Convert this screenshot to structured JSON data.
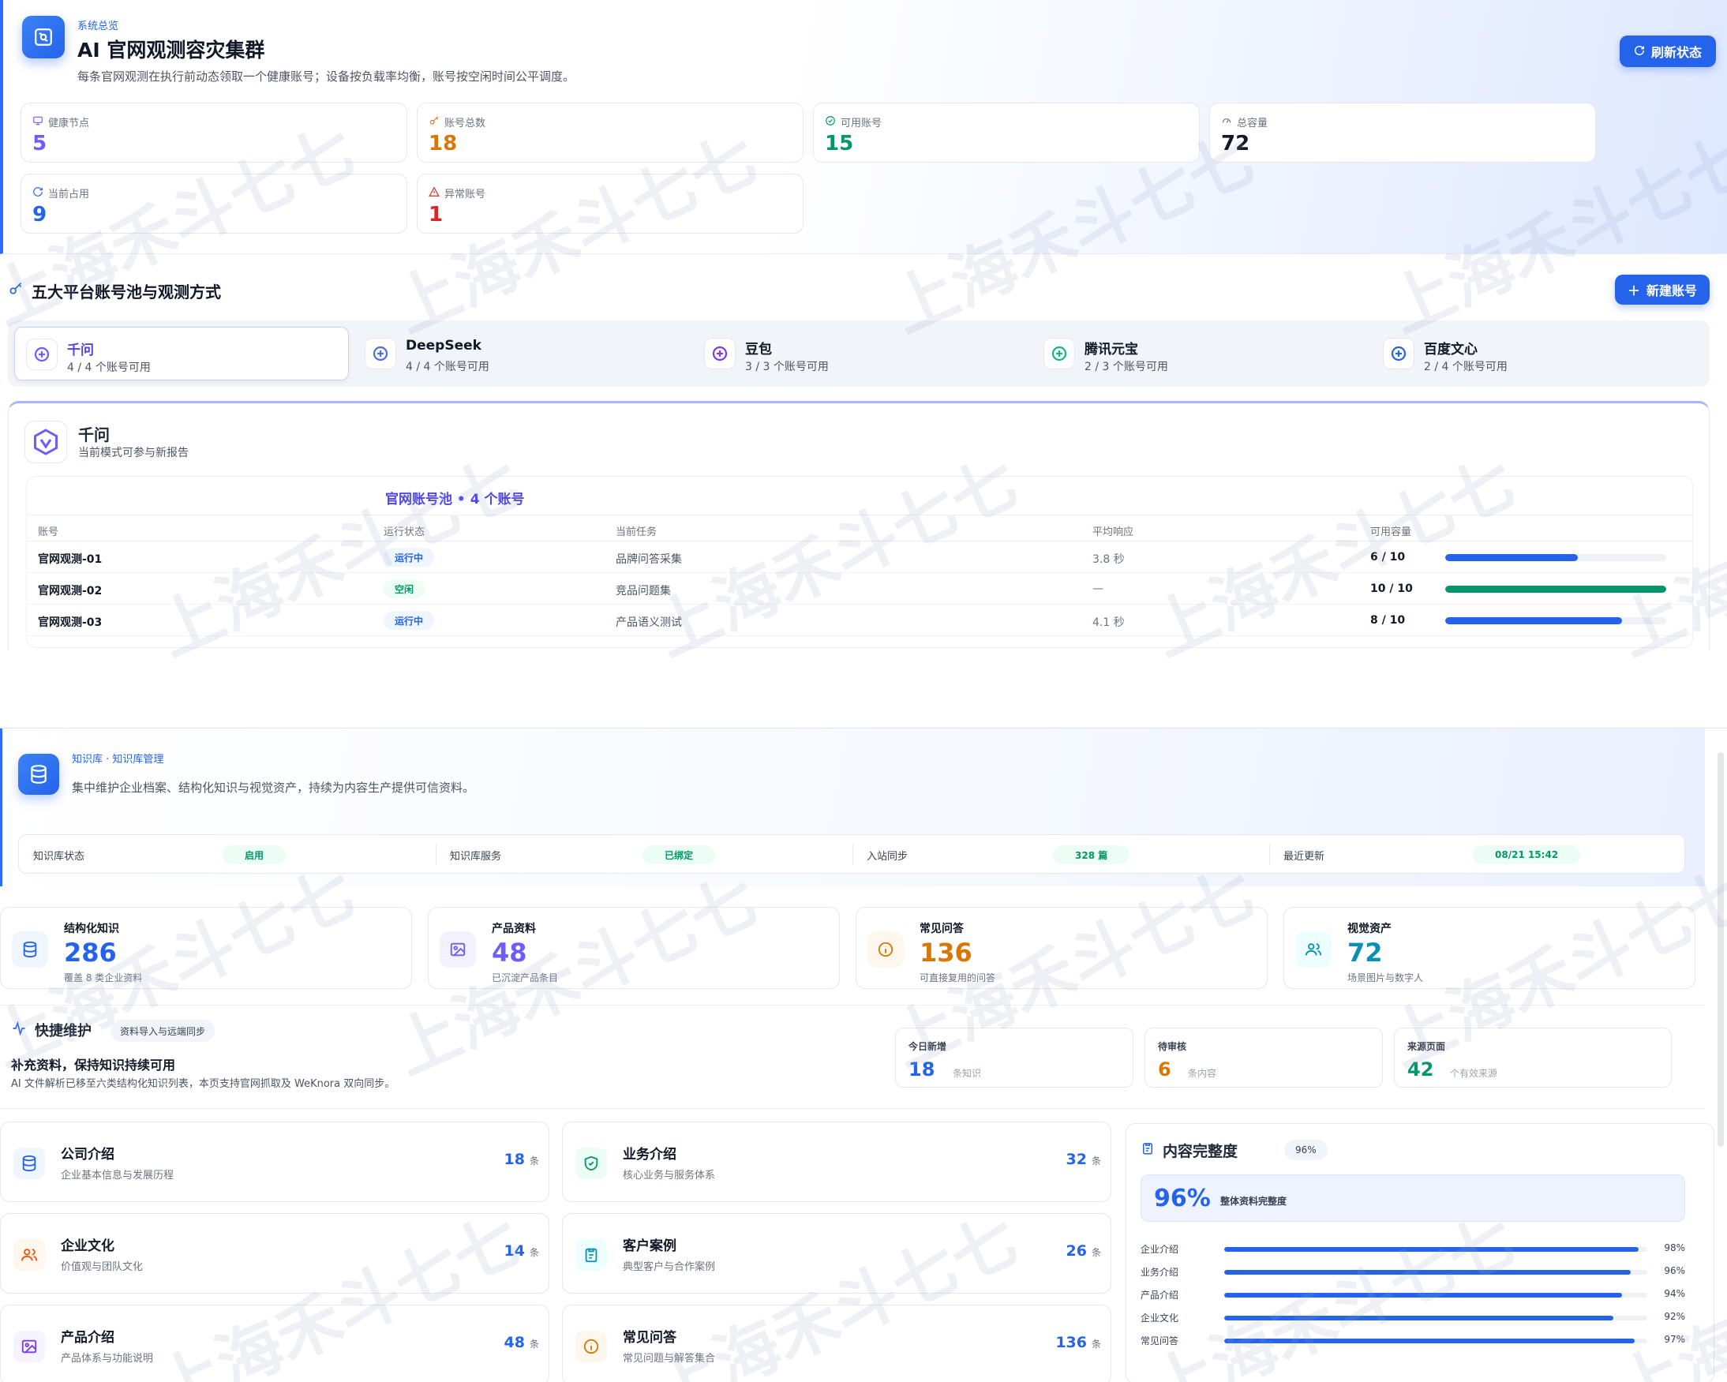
{
  "cluster": {
    "crumb": "系统总览",
    "title": "AI 官网观测容灾集群",
    "subtitle": "每条官网观测在执行前动态领取一个健康账号；设备按负载率均衡，账号按空闲时间公平调度。",
    "refresh_label": "刷新状态",
    "stats": [
      {
        "label": "健康节点",
        "value": "5",
        "icon": "monitor-icon",
        "color": "#6d5dfc"
      },
      {
        "label": "账号总数",
        "value": "18",
        "icon": "key-icon",
        "color": "#d97706"
      },
      {
        "label": "可用账号",
        "value": "15",
        "icon": "check-circle-icon",
        "color": "#059669"
      },
      {
        "label": "总容量",
        "value": "72",
        "icon": "gauge-icon",
        "color": "#111827"
      },
      {
        "label": "当前占用",
        "value": "9",
        "icon": "refresh-icon",
        "color": "#2563eb"
      },
      {
        "label": "异常账号",
        "value": "1",
        "icon": "warning-icon",
        "color": "#dc2626"
      }
    ]
  },
  "pool_section": {
    "title": "五大平台账号池与观测方式",
    "new_account_label": "新建账号",
    "platforms": [
      {
        "name": "千问",
        "count": "4 / 4 个账号可用",
        "active": true,
        "color": "#6d5dfc"
      },
      {
        "name": "DeepSeek",
        "count": "4 / 4 个账号可用",
        "active": false,
        "color": "#4f6bed"
      },
      {
        "name": "豆包",
        "count": "3 / 3 个账号可用",
        "active": false,
        "color": "#7c3aed"
      },
      {
        "name": "腾讯元宝",
        "count": "2 / 3 个账号可用",
        "active": false,
        "color": "#10b981"
      },
      {
        "name": "百度文心",
        "count": "2 / 4 个账号可用",
        "active": false,
        "color": "#2563eb"
      }
    ],
    "detail": {
      "name": "千问",
      "subtitle": "当前模式可参与新报告",
      "pool_title": "官网账号池 • 4 个账号",
      "columns": [
        "账号",
        "运行状态",
        "当前任务",
        "平均响应",
        "可用容量"
      ],
      "rows": [
        {
          "account": "官网观测-01",
          "status": "运行中",
          "status_type": "run",
          "task": "品牌问答采集",
          "latency": "3.8 秒",
          "capacity": "6 / 10",
          "fill": 0.6,
          "bar_color": "#2563eb"
        },
        {
          "account": "官网观测-02",
          "status": "空闲",
          "status_type": "idle",
          "task": "竞品问题集",
          "latency": "—",
          "capacity": "10 / 10",
          "fill": 1.0,
          "bar_color": "#059669"
        },
        {
          "account": "官网观测-03",
          "status": "运行中",
          "status_type": "run",
          "task": "产品语义测试",
          "latency": "4.1 秒",
          "capacity": "8 / 10",
          "fill": 0.8,
          "bar_color": "#2563eb"
        }
      ]
    }
  },
  "knowledge": {
    "crumb": "知识库 · 知识库管理",
    "subtitle": "集中维护企业档案、结构化知识与视觉资产，持续为内容生产提供可信资料。",
    "strip": [
      {
        "label": "知识库状态",
        "value": "启用"
      },
      {
        "label": "知识库服务",
        "value": "已绑定"
      },
      {
        "label": "入站同步",
        "value": "328 篇"
      },
      {
        "label": "最近更新",
        "value": "08/21 15:42"
      }
    ],
    "cards": [
      {
        "title": "结构化知识",
        "value": "286",
        "sub": "覆盖 8 类企业资料",
        "icon": "database-icon",
        "color": "#2563eb",
        "bg": "#eff6ff"
      },
      {
        "title": "产品资料",
        "value": "48",
        "sub": "已沉淀产品条目",
        "icon": "image-icon",
        "color": "#6d5dfc",
        "bg": "#f3f0ff"
      },
      {
        "title": "常见问答",
        "value": "136",
        "sub": "可直接复用的问答",
        "icon": "info-icon",
        "color": "#d97706",
        "bg": "#fff7ed"
      },
      {
        "title": "视觉资产",
        "value": "72",
        "sub": "场景图片与数字人",
        "icon": "users-icon",
        "color": "#0891b2",
        "bg": "#ecfeff"
      }
    ],
    "quick": {
      "title": "快捷维护",
      "tag": "资料导入与远端同步",
      "heading": "补充资料，保持知识持续可用",
      "desc": "AI 文件解析已移至六类结构化知识列表，本页支持官网抓取及 WeKnora 双向同步。",
      "stats": [
        {
          "label": "今日新增",
          "value": "18",
          "unit": "条知识",
          "color": "#2563eb"
        },
        {
          "label": "待审核",
          "value": "6",
          "unit": "条内容",
          "color": "#d97706"
        },
        {
          "label": "来源页面",
          "value": "42",
          "unit": "个有效来源",
          "color": "#059669"
        }
      ]
    },
    "categories": [
      {
        "title": "公司介绍",
        "sub": "企业基本信息与发展历程",
        "count": "18",
        "unit": "条",
        "icon": "database-icon",
        "color": "#2563eb",
        "bg": "#eff6ff"
      },
      {
        "title": "业务介绍",
        "sub": "核心业务与服务体系",
        "count": "32",
        "unit": "条",
        "icon": "shield-icon",
        "color": "#059669",
        "bg": "#ecfdf5"
      },
      {
        "title": "企业文化",
        "sub": "价值观与团队文化",
        "count": "14",
        "unit": "条",
        "icon": "users-icon",
        "color": "#ea580c",
        "bg": "#fff7ed"
      },
      {
        "title": "客户案例",
        "sub": "典型客户与合作案例",
        "count": "26",
        "unit": "条",
        "icon": "clipboard-icon",
        "color": "#0891b2",
        "bg": "#ecfeff"
      },
      {
        "title": "产品介绍",
        "sub": "产品体系与功能说明",
        "count": "48",
        "unit": "条",
        "icon": "image-icon",
        "color": "#7c3aed",
        "bg": "#f5f3ff"
      },
      {
        "title": "常见问答",
        "sub": "常见问题与解答集合",
        "count": "136",
        "unit": "条",
        "icon": "info-icon",
        "color": "#d97706",
        "bg": "#fff7ed"
      }
    ],
    "completeness": {
      "title": "内容完整度",
      "pill": "96%",
      "big": "96%",
      "big_label": "整体资料完整度",
      "rows": [
        {
          "label": "企业介绍",
          "pct": "98%",
          "value": 0.98
        },
        {
          "label": "业务介绍",
          "pct": "96%",
          "value": 0.96
        },
        {
          "label": "产品介绍",
          "pct": "94%",
          "value": 0.94
        },
        {
          "label": "企业文化",
          "pct": "92%",
          "value": 0.92
        },
        {
          "label": "常见问答",
          "pct": "97%",
          "value": 0.97
        }
      ]
    }
  },
  "watermark": "上海禾斗七七"
}
